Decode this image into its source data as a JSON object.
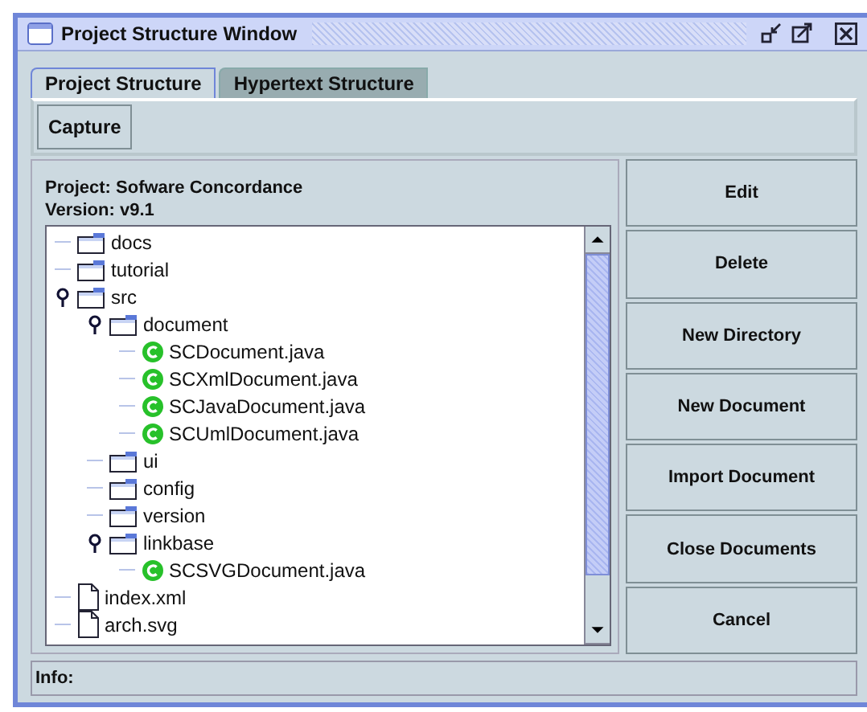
{
  "window": {
    "title": "Project Structure Window"
  },
  "tabs": [
    {
      "label": "Project Structure",
      "selected": true
    },
    {
      "label": "Hypertext Structure",
      "selected": false
    }
  ],
  "toolbar": [
    "Capture"
  ],
  "project": {
    "name": "Project: Sofware Concordance",
    "version": "Version: v9.1"
  },
  "tree": [
    {
      "label": "docs",
      "kind": "folder"
    },
    {
      "label": "tutorial",
      "kind": "folder"
    },
    {
      "label": "src",
      "kind": "folder",
      "expanded": true,
      "children": [
        {
          "label": "document",
          "kind": "folder",
          "expanded": true,
          "children": [
            {
              "label": "SCDocument.java",
              "kind": "class"
            },
            {
              "label": "SCXmlDocument.java",
              "kind": "class"
            },
            {
              "label": "SCJavaDocument.java",
              "kind": "class"
            },
            {
              "label": "SCUmlDocument.java",
              "kind": "class"
            }
          ]
        },
        {
          "label": "ui",
          "kind": "folder"
        },
        {
          "label": "config",
          "kind": "folder"
        },
        {
          "label": "version",
          "kind": "folder"
        },
        {
          "label": "linkbase",
          "kind": "folder",
          "expanded": true,
          "children": [
            {
              "label": "SCSVGDocument.java",
              "kind": "class"
            }
          ]
        }
      ]
    },
    {
      "label": "index.xml",
      "kind": "file"
    },
    {
      "label": "arch.svg",
      "kind": "file"
    }
  ],
  "buttons": [
    "Edit",
    "Delete",
    "New Directory",
    "New Document",
    "Import Document",
    "Close Documents",
    "Cancel"
  ],
  "status_bar": {
    "label": "Info:"
  }
}
